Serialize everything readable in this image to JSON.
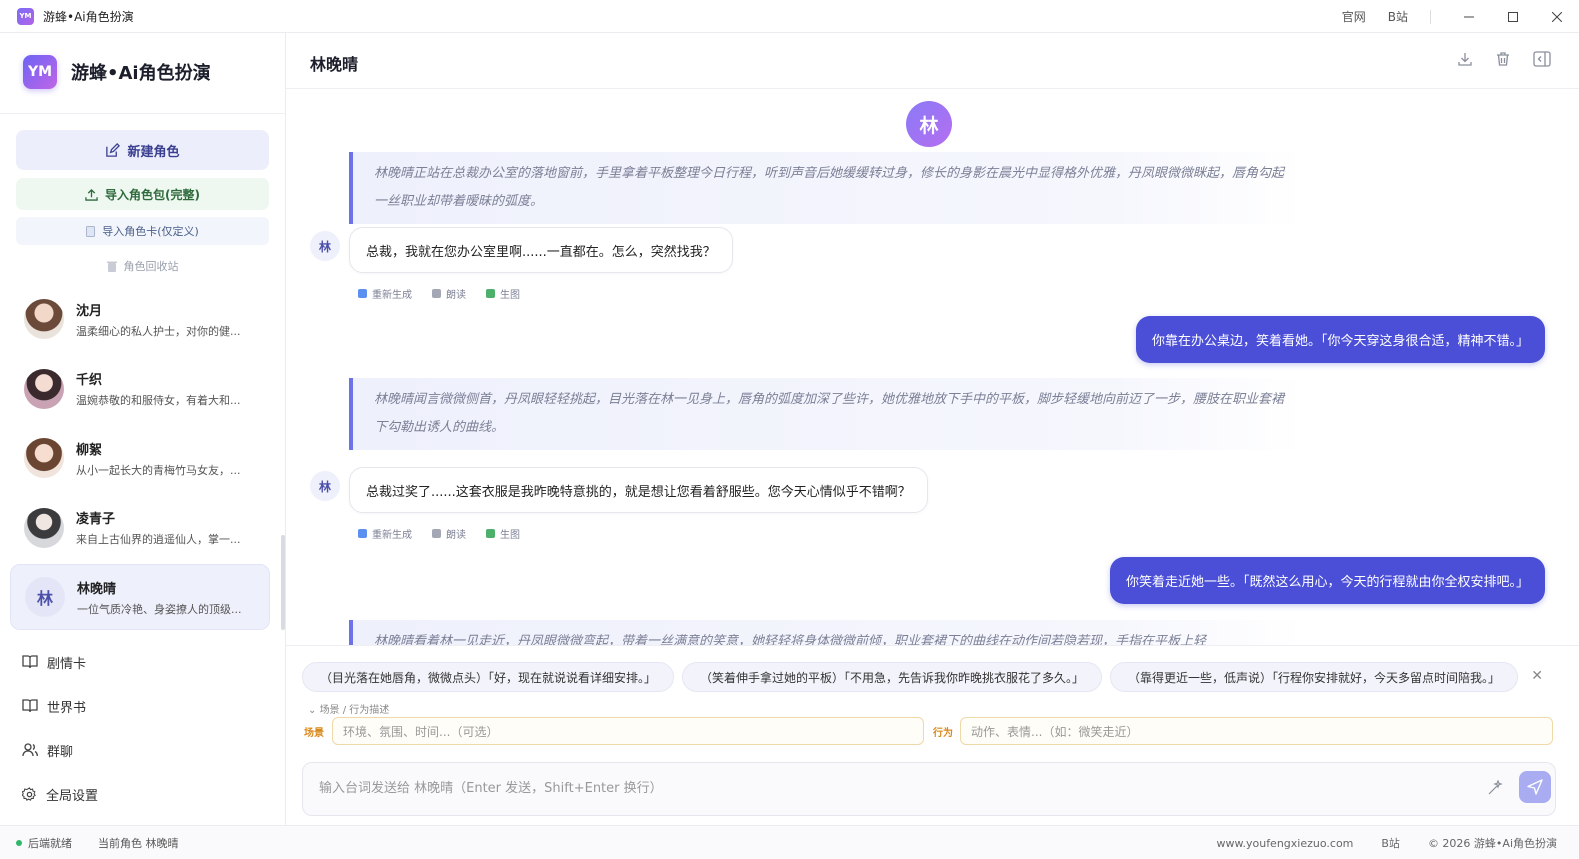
{
  "window": {
    "title": "游蜂•Ai角色扮演",
    "logo_text": "YM",
    "links": [
      "官网",
      "B站"
    ]
  },
  "sidebar": {
    "brand_logo": "YM",
    "brand_title": "游蜂•Ai角色扮演",
    "new_role": "新建角色",
    "import_pack": "导入角色包(完整)",
    "import_card": "导入角色卡(仅定义)",
    "recycle_bin": "角色回收站",
    "characters": [
      {
        "name": "沈月",
        "desc": "温柔细心的私人护士，对你的健...",
        "avatar_color": "#8d6e63"
      },
      {
        "name": "千织",
        "desc": "温婉恭敬的和服侍女，有着大和...",
        "avatar_color": "#b07a86"
      },
      {
        "name": "柳絮",
        "desc": "从小一起长大的青梅竹马女友，...",
        "avatar_color": "#c89a7c"
      },
      {
        "name": "凌青子",
        "desc": "来自上古仙界的逍遥仙人，掌一...",
        "avatar_color": "#9fa3a8"
      },
      {
        "name": "林晚晴",
        "desc": "一位气质冷艳、身姿撩人的顶级...",
        "avatar_text": "林"
      }
    ],
    "nav": [
      "剧情卡",
      "世界书",
      "群聊",
      "全局设置"
    ]
  },
  "status": {
    "ready": "后端就绪",
    "current_role": "当前角色 林晚晴",
    "site": "www.youfengxiezuo.com",
    "bili": "B站",
    "copyright": "© 2026 游蜂•Ai角色扮演"
  },
  "chat": {
    "title": "林晚晴",
    "avatar_text": "林",
    "narration_1": "林晚晴正站在总裁办公室的落地窗前，手里拿着平板整理今日行程，听到声音后她缓缓转过身，修长的身影在晨光中显得格外优雅，丹凤眼微微眯起，唇角勾起一丝职业却带着暧昧的弧度。",
    "reply_1": "总裁，我就在您办公室里啊......一直都在。怎么，突然找我？",
    "user_1": "你靠在办公桌边，笑着看她。「你今天穿这身很合适，精神不错。」",
    "narration_2": "林晚晴闻言微微侧首，丹凤眼轻轻挑起，目光落在林一见身上，唇角的弧度加深了些许，她优雅地放下手中的平板，脚步轻缓地向前迈了一步，腰肢在职业套裙下勾勒出诱人的曲线。",
    "reply_2": "总裁过奖了......这套衣服是我昨晚特意挑的，就是想让您看着舒服些。您今天心情似乎不错啊？",
    "user_2": "你笑着走近她一些。「既然这么用心，今天的行程就由你全权安排吧。」",
    "narration_3": "林晚晴看着林一见走近，丹凤眼微微弯起，带着一丝满意的笑意，她轻轻将身体微微前倾，职业套裙下的曲线在动作间若隐若现，手指在平板上轻",
    "actions": {
      "regen": "重新生成",
      "read": "朗读",
      "image": "生图"
    }
  },
  "composer": {
    "suggestions": [
      "（目光落在她唇角，微微点头）「好，现在就说说看详细安排。」",
      "（笑着伸手拿过她的平板）「不用急，先告诉我你昨晚挑衣服花了多久。」",
      "（靠得更近一些，低声说）「行程你安排就好，今天多留点时间陪我。」"
    ],
    "scene_toggle": "场景 / 行为描述",
    "scene_label": "场景",
    "scene_placeholder": "环境、氛围、时间...（可选）",
    "action_label": "行为",
    "action_placeholder": "动作、表情...（如：微笑走近）",
    "input_placeholder": "输入台词发送给 林晚晴（Enter 发送，Shift+Enter 换行）"
  }
}
